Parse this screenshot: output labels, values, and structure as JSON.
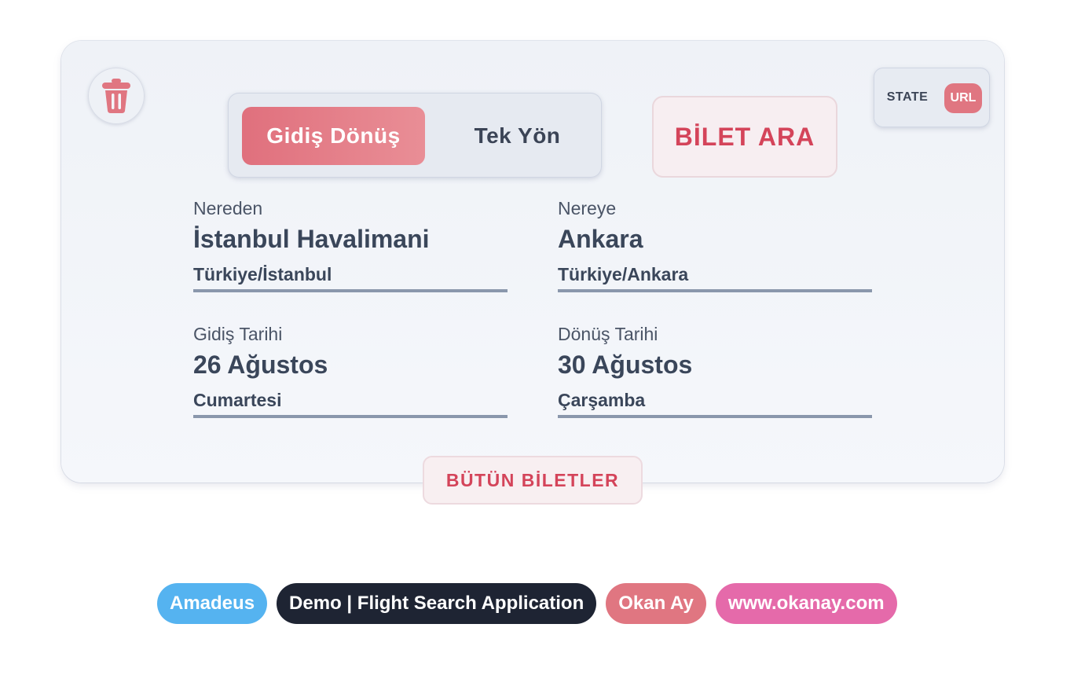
{
  "card": {
    "delete_icon": "trash-icon",
    "trip_type": {
      "options": [
        "Gidiş Dönüş",
        "Tek Yön"
      ],
      "selected": "Gidiş Dönüş"
    },
    "search_button_label": "BİLET ARA",
    "mode_switch": {
      "options": [
        "STATE",
        "URL"
      ],
      "selected": "URL"
    },
    "from": {
      "label": "Nereden",
      "value": "İstanbul Havalimani",
      "sub": "Türkiye/İstanbul"
    },
    "to": {
      "label": "Nereye",
      "value": "Ankara",
      "sub": "Türkiye/Ankara"
    },
    "departure": {
      "label": "Gidiş Tarihi",
      "value": "26 Ağustos",
      "sub": "Cumartesi"
    },
    "return": {
      "label": "Dönüş Tarihi",
      "value": "30 Ağustos",
      "sub": "Çarşamba"
    },
    "all_tickets_label": "BÜTÜN BİLETLER"
  },
  "badges": [
    {
      "label": "Amadeus",
      "color": "#55b3f0"
    },
    {
      "label": "Demo | Flight Search Application",
      "color": "#1e2433"
    },
    {
      "label": "Okan Ay",
      "color": "#e07681"
    },
    {
      "label": "www.okanay.com",
      "color": "#e56aaa"
    }
  ],
  "colors": {
    "accent": "#e07681",
    "accent_text": "#d4445a",
    "text": "#3a465a",
    "field_underline": "#8a97ac"
  }
}
